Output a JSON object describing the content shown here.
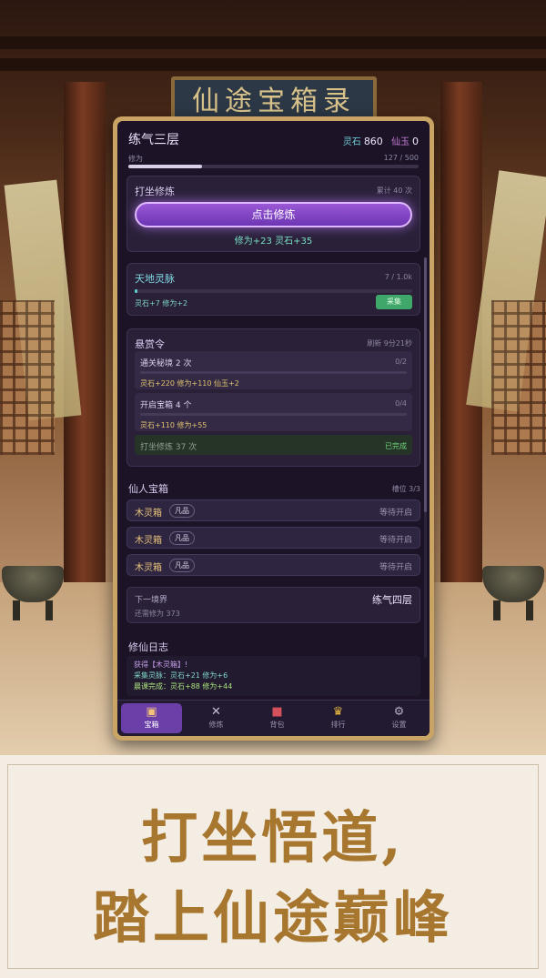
{
  "background": {
    "plaque_text": "仙途宝箱录"
  },
  "header": {
    "realm": "练气三层",
    "spirit_stone_label": "灵石",
    "spirit_stone_value": "860",
    "immortal_jade_label": "仙玉",
    "immortal_jade_value": "0",
    "cultivation_label": "修为",
    "cultivation_progress": "127 / 500",
    "cultivation_fraction": 0.254
  },
  "meditate": {
    "title": "打坐修炼",
    "count_note": "累计 40 次",
    "button_label": "点击修炼",
    "gain_text": "修为+23  灵石+35"
  },
  "spirit_vein": {
    "title": "天地灵脉",
    "progress": "7 / 1.0k",
    "fraction": 0.007,
    "yield_text": "灵石+7 修为+2",
    "collect_label": "采集"
  },
  "bounty": {
    "title": "悬赏令",
    "refresh_note": "刷新 9分21秒",
    "quests": [
      {
        "title": "通关秘境 2 次",
        "progress": "0/2",
        "reward": "灵石+220  修为+110  仙玉+2"
      },
      {
        "title": "开启宝箱 4 个",
        "progress": "0/4",
        "reward": "灵石+110  修为+55"
      },
      {
        "title": "打坐修炼 37 次",
        "progress": "已完成",
        "reward": ""
      }
    ]
  },
  "chests": {
    "title": "仙人宝箱",
    "slots_note": "槽位 3/3",
    "items": [
      {
        "name": "木灵箱",
        "tier": "凡品",
        "status": "等待开启"
      },
      {
        "name": "木灵箱",
        "tier": "凡品",
        "status": "等待开启"
      },
      {
        "name": "木灵箱",
        "tier": "凡品",
        "status": "等待开启"
      }
    ]
  },
  "next_realm": {
    "label": "下一境界",
    "value": "练气四层",
    "requirement": "还需修为 373"
  },
  "log": {
    "title": "修仙日志",
    "lines": [
      "获得【木灵箱】!",
      "采集灵脉：灵石+21 修为+6",
      "晨课完成：灵石+88 修为+44"
    ]
  },
  "tabs": [
    {
      "label": "宝箱",
      "icon": "chest-icon"
    },
    {
      "label": "修炼",
      "icon": "swords-icon"
    },
    {
      "label": "背包",
      "icon": "bag-icon"
    },
    {
      "label": "排行",
      "icon": "trophy-icon"
    },
    {
      "label": "设置",
      "icon": "gear-icon"
    }
  ],
  "caption": {
    "line1": "打坐悟道,",
    "line2": "踏上仙途巅峰"
  }
}
